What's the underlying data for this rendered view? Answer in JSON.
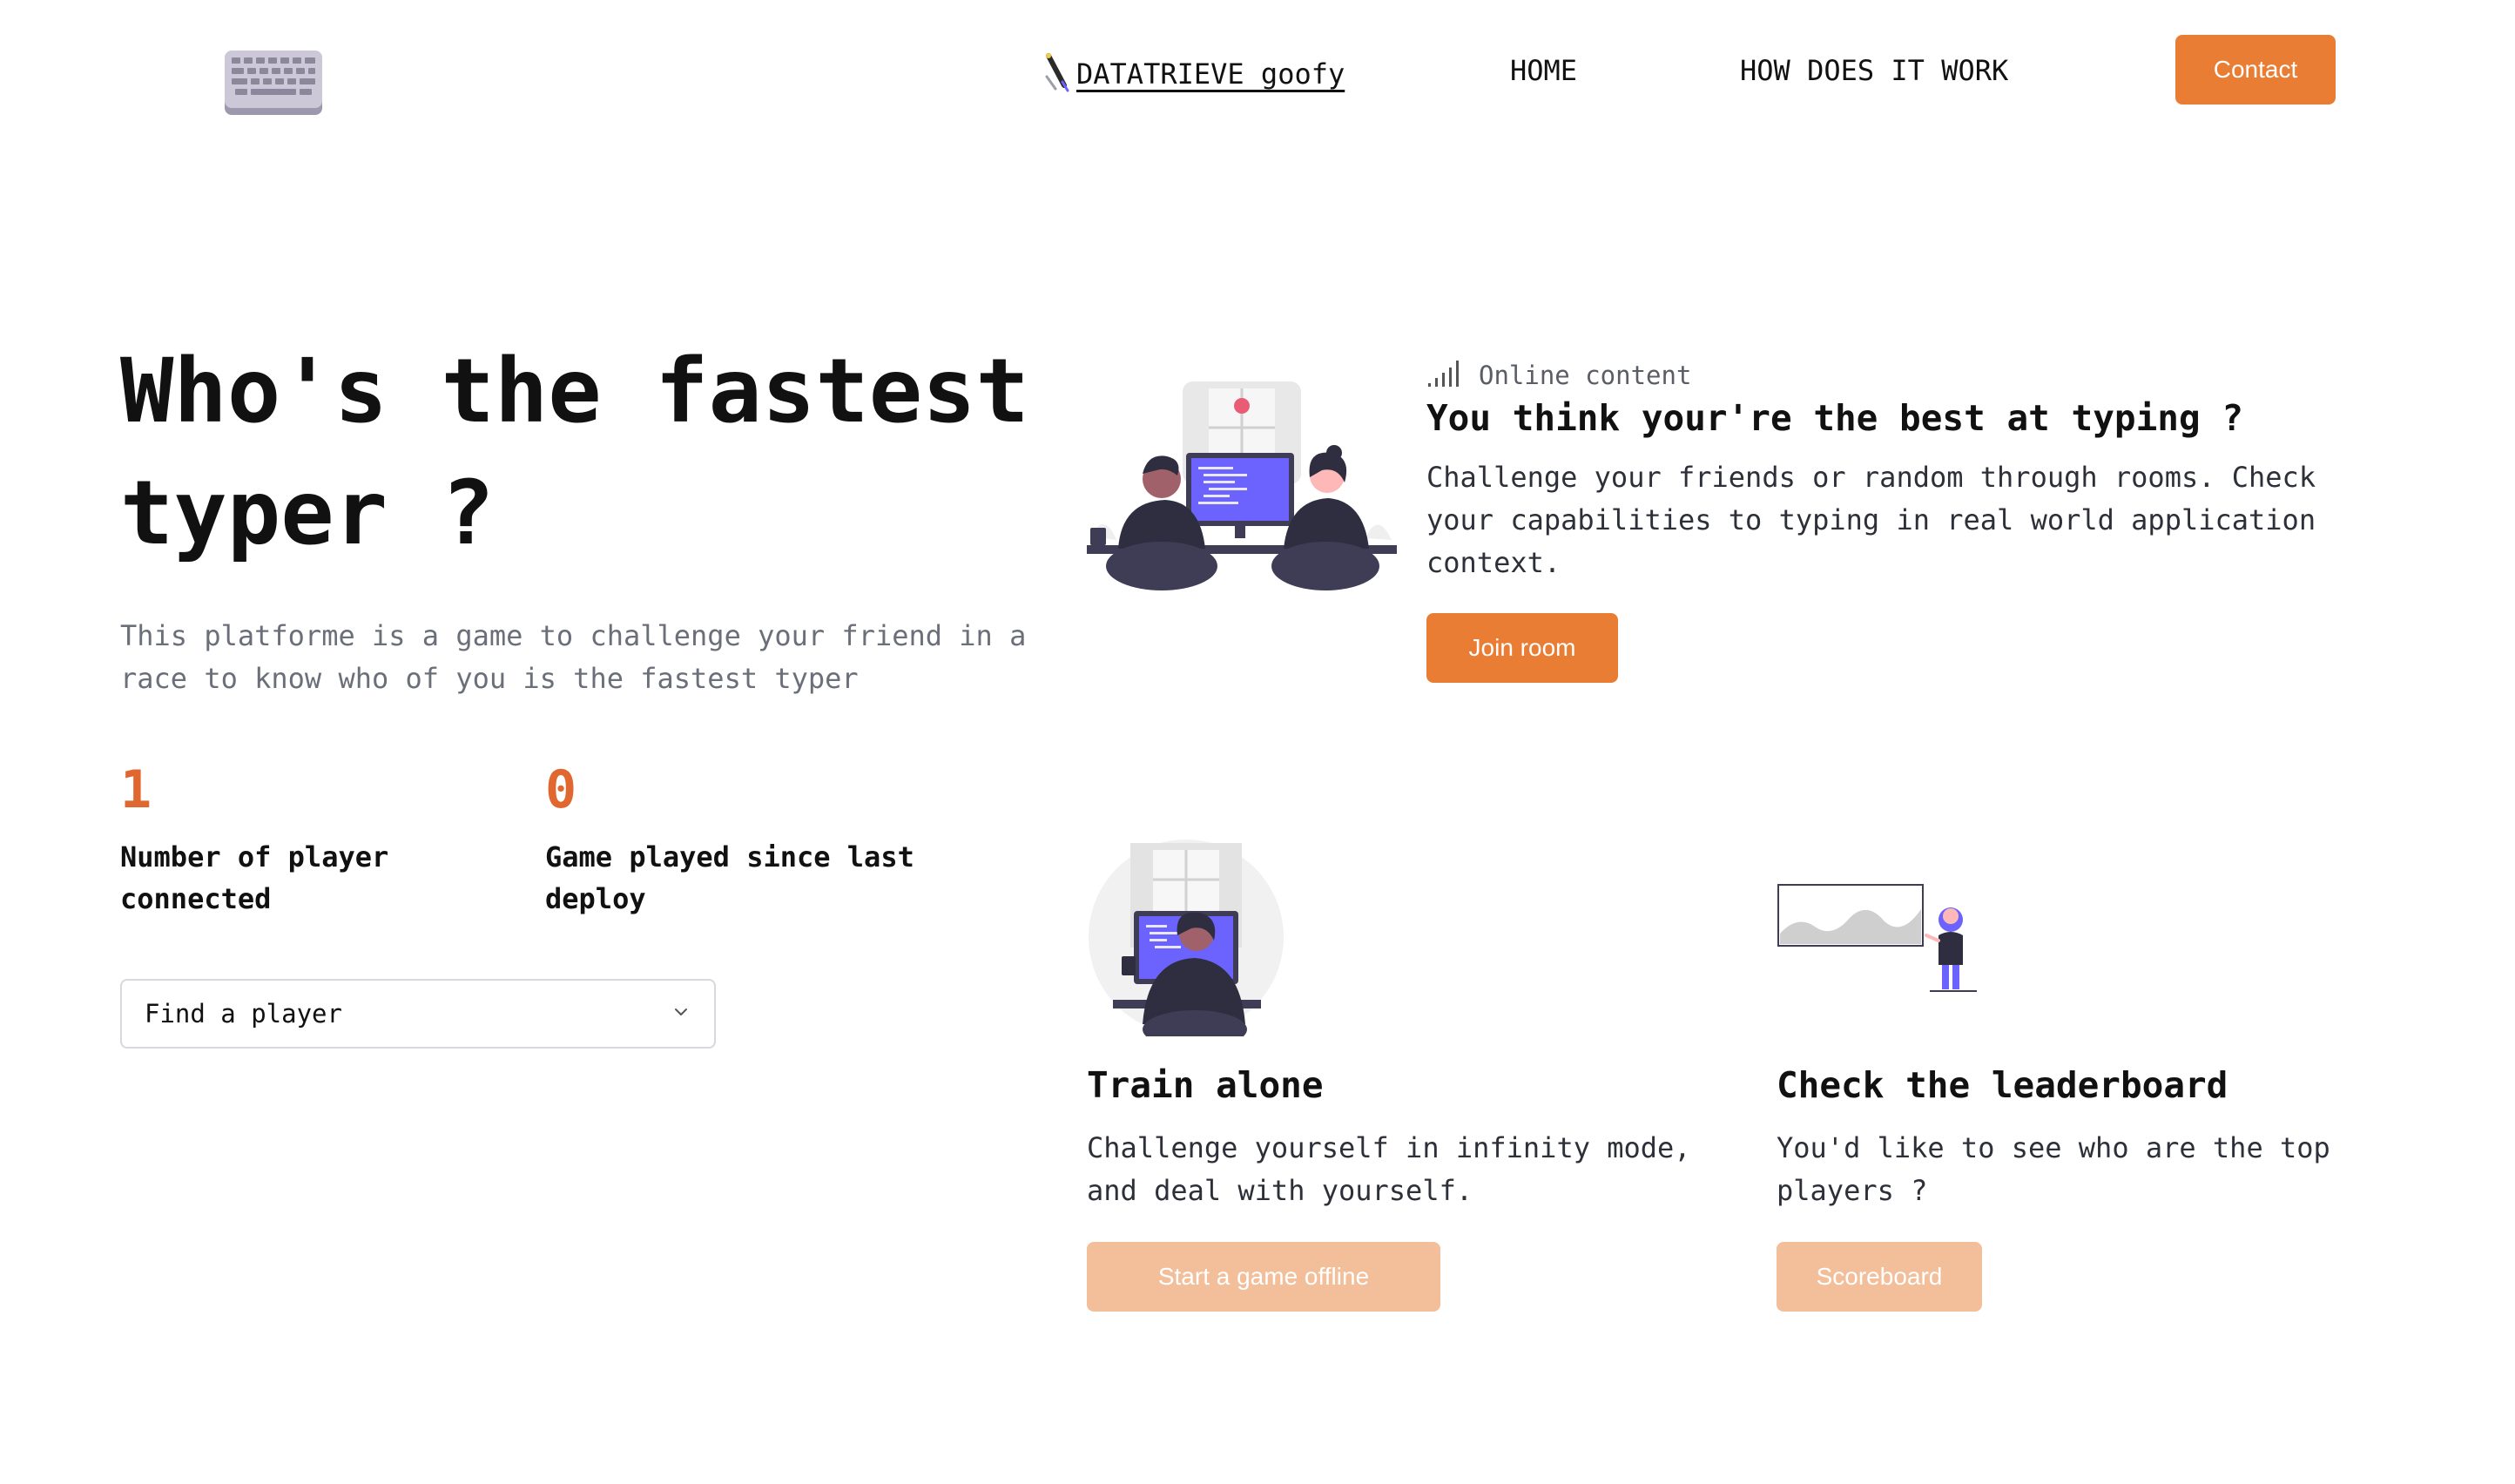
{
  "header": {
    "logo_icon": "keyboard-icon",
    "brand_label": "DATATRIEVE goofy",
    "brand_icon": "pen-icon",
    "nav": [
      {
        "label": "HOME"
      },
      {
        "label": "HOW DOES IT WORK"
      }
    ],
    "contact_label": "Contact"
  },
  "hero": {
    "title": "Who's the fastest typer ?",
    "subtitle": "This platforme is a game to challenge your friend in a race to know who of you is the fastest typer",
    "stats": [
      {
        "value": "1",
        "label": "Number of player connected"
      },
      {
        "value": "0",
        "label": "Game played since last deploy"
      }
    ],
    "find_player": {
      "selected": "Find a player"
    }
  },
  "cards": {
    "online": {
      "badge": "Online content",
      "badge_icon": "signal-bars-icon",
      "title": "You think your're the best at typing ?",
      "description": "Challenge your friends or random through rooms. Check your capabilities to typing in real world application context.",
      "button": "Join room"
    },
    "train": {
      "title": "Train alone",
      "description": "Challenge yourself in infinity mode, and deal with yourself.",
      "button": "Start a game offline"
    },
    "leaderboard": {
      "title": "Check the leaderboard",
      "description": "You'd like to see who are the top players ?",
      "button": "Scoreboard"
    }
  },
  "colors": {
    "accent": "#e97d34",
    "accent_light": "#f3bf9a",
    "stat_number": "#e0672f",
    "illustration_purple": "#6c63ff"
  }
}
